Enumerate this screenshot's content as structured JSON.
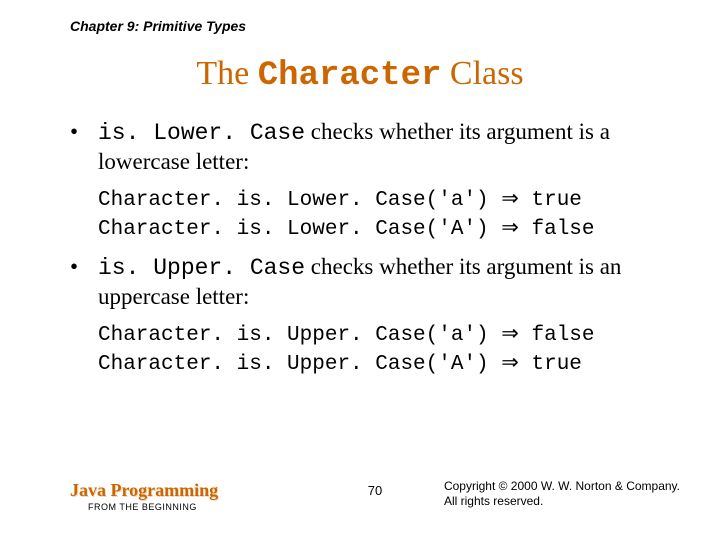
{
  "chapter": "Chapter 9: Primitive Types",
  "title": {
    "pre": "The ",
    "mono": "Character",
    "post": " Class"
  },
  "bullets": [
    {
      "code": "is. Lower. Case",
      "text_after": " checks whether its argument is a lowercase letter:"
    },
    {
      "code": "is. Upper. Case",
      "text_after": " checks whether its argument is an uppercase letter:"
    }
  ],
  "examples": {
    "lower": {
      "line1_call": "Character. is. Lower. Case('a')",
      "line1_result": "true",
      "line2_call": "Character. is. Lower. Case('A')",
      "line2_result": "false"
    },
    "upper": {
      "line1_call": "Character. is. Upper. Case('a')",
      "line1_result": "false",
      "line2_call": "Character. is. Upper. Case('A')",
      "line2_result": "true"
    }
  },
  "arrow": "⇒",
  "footer": {
    "book_title": "Java Programming",
    "subtitle": "FROM THE BEGINNING",
    "page": "70",
    "copyright_line1": "Copyright © 2000 W. W. Norton & Company.",
    "copyright_line2": "All rights reserved."
  }
}
